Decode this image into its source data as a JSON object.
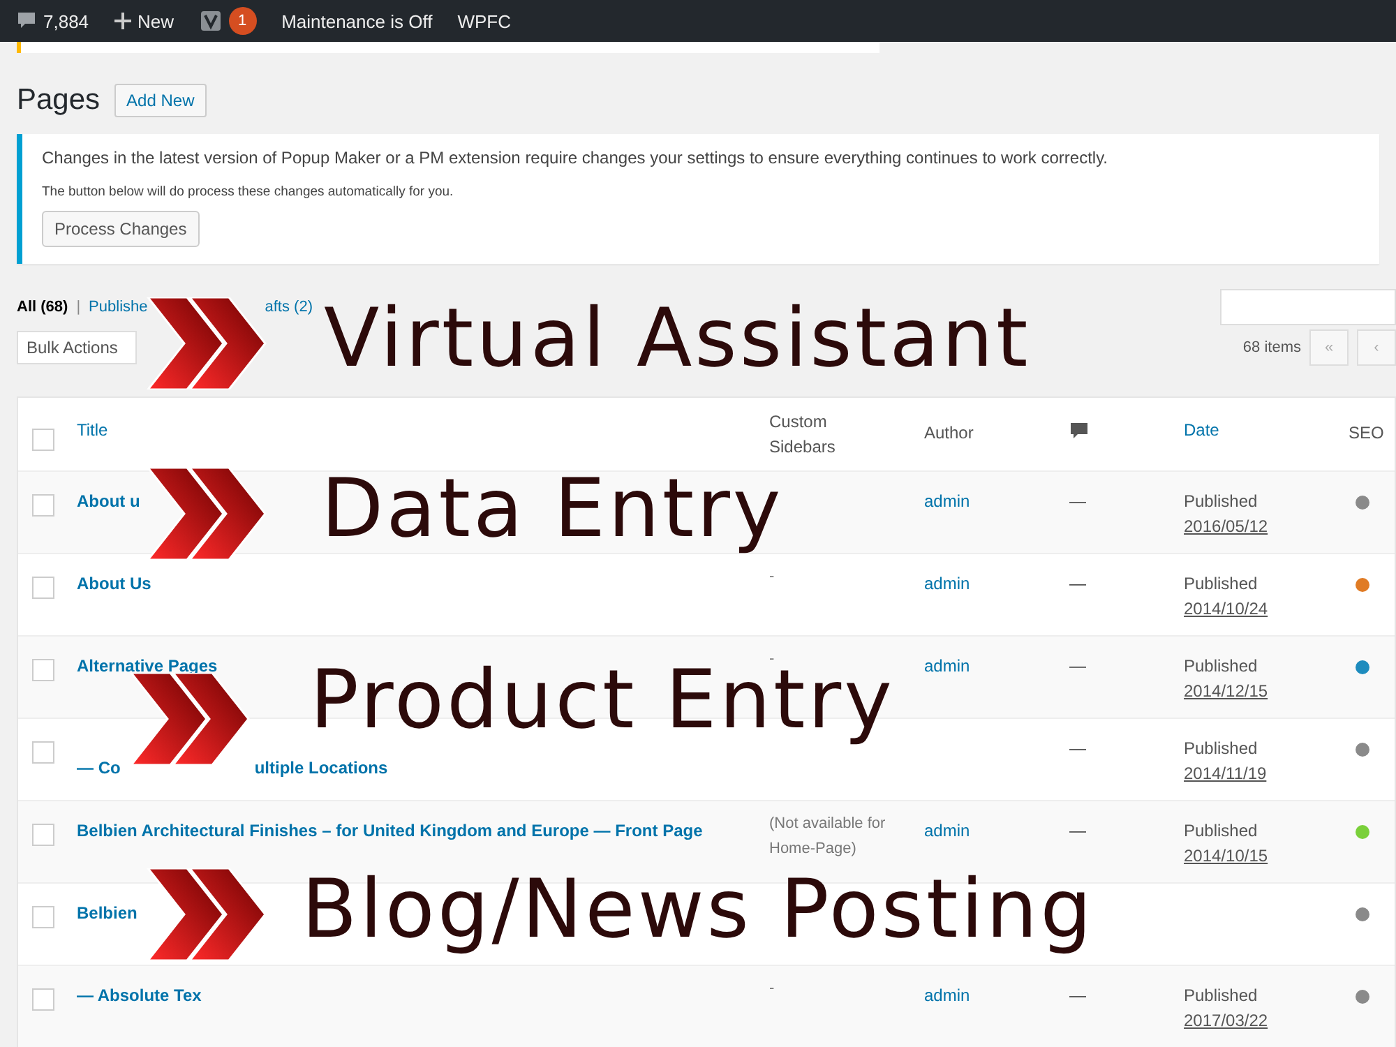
{
  "admin_bar": {
    "comments": "7,884",
    "new": "New",
    "badge": "1",
    "maintenance": "Maintenance is Off",
    "cache": "WPFC"
  },
  "page": {
    "title": "Pages",
    "add_new": "Add New"
  },
  "notice": {
    "line_1": "Changes in the latest version of Popup Maker or a PM extension require changes your settings to ensure everything continues to work correctly.",
    "line_2": "The button below will do process these changes automatically for you.",
    "button": "Process Changes"
  },
  "views": [
    {
      "label": "All (68)",
      "selected": true
    },
    {
      "label": "Publishe",
      "selected": false
    },
    {
      "label": "afts (2)",
      "selected": false
    }
  ],
  "views_separator": "|",
  "toolbar": {
    "bulk_actions": "Bulk Actions",
    "count": "68 items",
    "first_page": "«",
    "prev_page": "‹"
  },
  "table": {
    "select_all_checked": false,
    "columns": [
      "Title",
      "Custom Sidebars",
      "Author",
      "Date",
      "SEO"
    ],
    "rows": [
      {
        "checked": false,
        "title": [
          "About u"
        ],
        "author": "admin",
        "comments": "—",
        "status": "Published",
        "date": "2016/05/12",
        "color": "#8a8a8a"
      },
      {
        "checked": false,
        "title": [
          "About Us"
        ],
        "sidebars": "-",
        "author": "admin",
        "comments": "—",
        "status": "Published",
        "date": "2014/10/24",
        "color": "#e07b24"
      },
      {
        "checked": false,
        "title": [
          "Alternative Pages"
        ],
        "sidebars": "-",
        "author": "admin",
        "comments": "—",
        "status": "Published",
        "date": "2014/12/15",
        "color": "#1e8cbe"
      },
      {
        "checked": false,
        "title": [
          "— Co",
          "ultiple Locations"
        ],
        "comments": "—",
        "status": "Published",
        "date": "2014/11/19",
        "color": "#8a8a8a"
      },
      {
        "checked": false,
        "title": [
          "Belbien Architectural Finishes – for United Kingdom and Europe — Front Page"
        ],
        "sidebars": "(Not available for Home-Page)",
        "author": "admin",
        "comments": "—",
        "status": "Published",
        "date": "2014/10/15",
        "color": "#7ad03a"
      },
      {
        "checked": false,
        "title": [
          "Belbien"
        ],
        "color": "#8a8a8a"
      },
      {
        "checked": false,
        "title": [
          "— Absolute Tex"
        ],
        "sidebars": "-",
        "author": "admin",
        "comments": "—",
        "status": "Published",
        "date": "2017/03/22",
        "color": "#8a8a8a"
      }
    ]
  },
  "banners": [
    {
      "text": "Virtual Assistant"
    },
    {
      "text": "Data Entry"
    },
    {
      "text": "Product Entry"
    },
    {
      "text": "Blog/News Posting"
    }
  ]
}
